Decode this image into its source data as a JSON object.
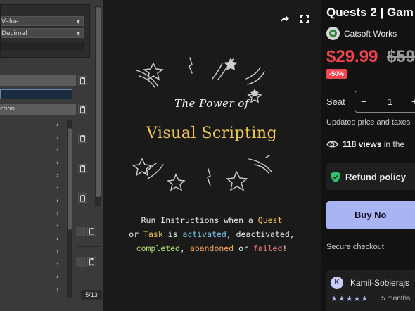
{
  "gallery": {
    "editor": {
      "dropdown1": "Value",
      "dropdown2": "Decimal",
      "row_label": "ction"
    },
    "hero": {
      "title_small": "The Power of",
      "title_big": "Visual Scripting",
      "line1": [
        "Run Instructions when a ",
        "Quest"
      ],
      "line2": [
        "or ",
        "Task",
        " is ",
        "activated",
        ", ",
        "deactivated",
        ","
      ],
      "line3": [
        "completed",
        ", ",
        "abandoned",
        " or ",
        "failed",
        "!"
      ]
    },
    "counter": "5/13",
    "icons": {
      "share": "share-icon",
      "fullscreen": "fullscreen-icon"
    }
  },
  "product": {
    "title": "Quests 2 | Gam",
    "seller": "Catsoft Works",
    "price": "$29.99",
    "price_original": "$59",
    "discount": "-50%",
    "seat_label": "Seat",
    "seat_minus": "−",
    "seat_qty": "1",
    "seat_plus": "+",
    "price_note": "Updated price and taxes",
    "views_count": "118 views",
    "views_suffix": " in the",
    "refund": "Refund policy",
    "buy": "Buy No",
    "secure": "Secure checkout:",
    "review": {
      "avatar": "K",
      "name": "Kamil-Sobierajs",
      "stars": "★★★★★",
      "ago": "5 months"
    },
    "colors": {
      "price": "#f0444e",
      "buy": "#a9b4f5",
      "refund_icon": "#2fbf71"
    }
  }
}
